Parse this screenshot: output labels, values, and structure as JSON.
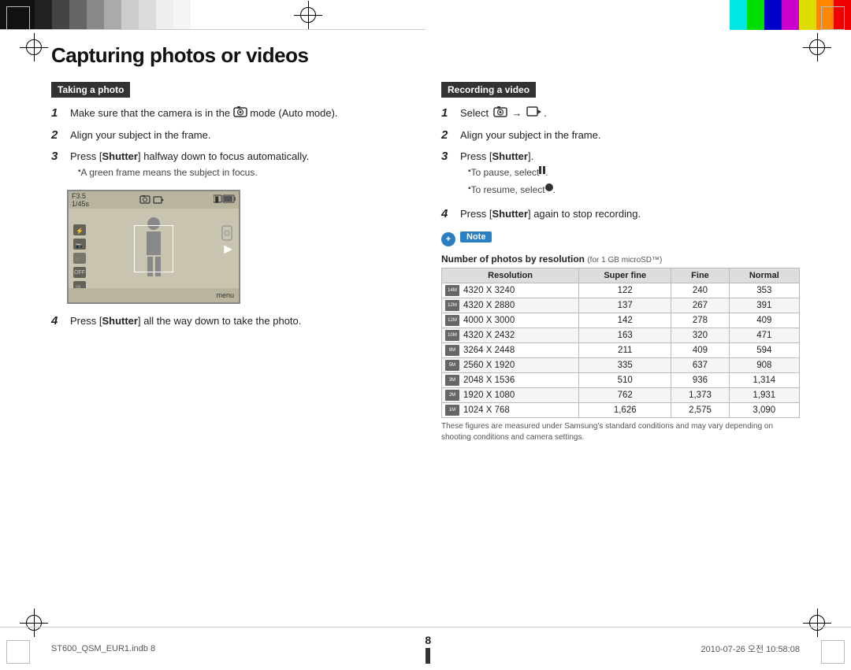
{
  "page": {
    "title": "Capturing photos or videos",
    "number": "8",
    "footer_left": "ST600_QSM_EUR1.indb   8",
    "footer_right": "2010-07-26   오전 10:58:08"
  },
  "left_section": {
    "header": "Taking a photo",
    "steps": [
      {
        "number": "1",
        "text": "Make sure that the camera is in the ",
        "suffix": " mode (Auto mode)."
      },
      {
        "number": "2",
        "text": "Align your subject in the frame."
      },
      {
        "number": "3",
        "text": "Press [Shutter] halfway down to focus automatically.",
        "sub": [
          "A green frame means the subject in focus."
        ]
      },
      {
        "number": "4",
        "text": "Press [Shutter] all the way down to take the photo."
      }
    ]
  },
  "right_section": {
    "header": "Recording a video",
    "steps": [
      {
        "number": "1",
        "text": "Select "
      },
      {
        "number": "2",
        "text": "Align your subject in the frame."
      },
      {
        "number": "3",
        "text": "Press [Shutter].",
        "sub": [
          "To pause, select ▐▐.",
          "To resume, select ●."
        ]
      },
      {
        "number": "4",
        "text": "Press [Shutter] again to stop recording."
      }
    ],
    "note_label": "Note",
    "table_title": "Number of photos by resolution",
    "table_subtitle": "(for 1 GB microSD™)",
    "table_headers": [
      "Resolution",
      "Super fine",
      "Fine",
      "Normal"
    ],
    "table_rows": [
      {
        "icon": "14M",
        "res": "4320 X 3240",
        "sf": "122",
        "f": "240",
        "n": "353"
      },
      {
        "icon": "12M",
        "res": "4320 X 2880",
        "sf": "137",
        "f": "267",
        "n": "391"
      },
      {
        "icon": "12M",
        "res": "4000 X 3000",
        "sf": "142",
        "f": "278",
        "n": "409"
      },
      {
        "icon": "10M",
        "res": "4320 X 2432",
        "sf": "163",
        "f": "320",
        "n": "471"
      },
      {
        "icon": "8M",
        "res": "3264 X 2448",
        "sf": "211",
        "f": "409",
        "n": "594"
      },
      {
        "icon": "5M",
        "res": "2560 X 1920",
        "sf": "335",
        "f": "637",
        "n": "908"
      },
      {
        "icon": "3M",
        "res": "2048 X 1536",
        "sf": "510",
        "f": "936",
        "n": "1,314"
      },
      {
        "icon": "2M",
        "res": "1920 X 1080",
        "sf": "762",
        "f": "1,373",
        "n": "1,931"
      },
      {
        "icon": "1M",
        "res": "1024 X 768",
        "sf": "1,626",
        "f": "2,575",
        "n": "3,090"
      }
    ],
    "table_note": "These figures are measured under Samsung's standard conditions and may vary depending on shooting conditions and camera settings."
  },
  "colors": {
    "section_header_bg": "#333333",
    "note_blue": "#2a7fc2",
    "accent": "#222222"
  },
  "top_bar": {
    "grayscale": [
      "#111",
      "#333",
      "#555",
      "#777",
      "#999",
      "#bbb",
      "#ddd",
      "#fff"
    ],
    "colors_right": [
      "#00ffff",
      "#00ff00",
      "#0000ff",
      "#ff00ff",
      "#ffff00",
      "#ff8800",
      "#ff0000"
    ]
  }
}
